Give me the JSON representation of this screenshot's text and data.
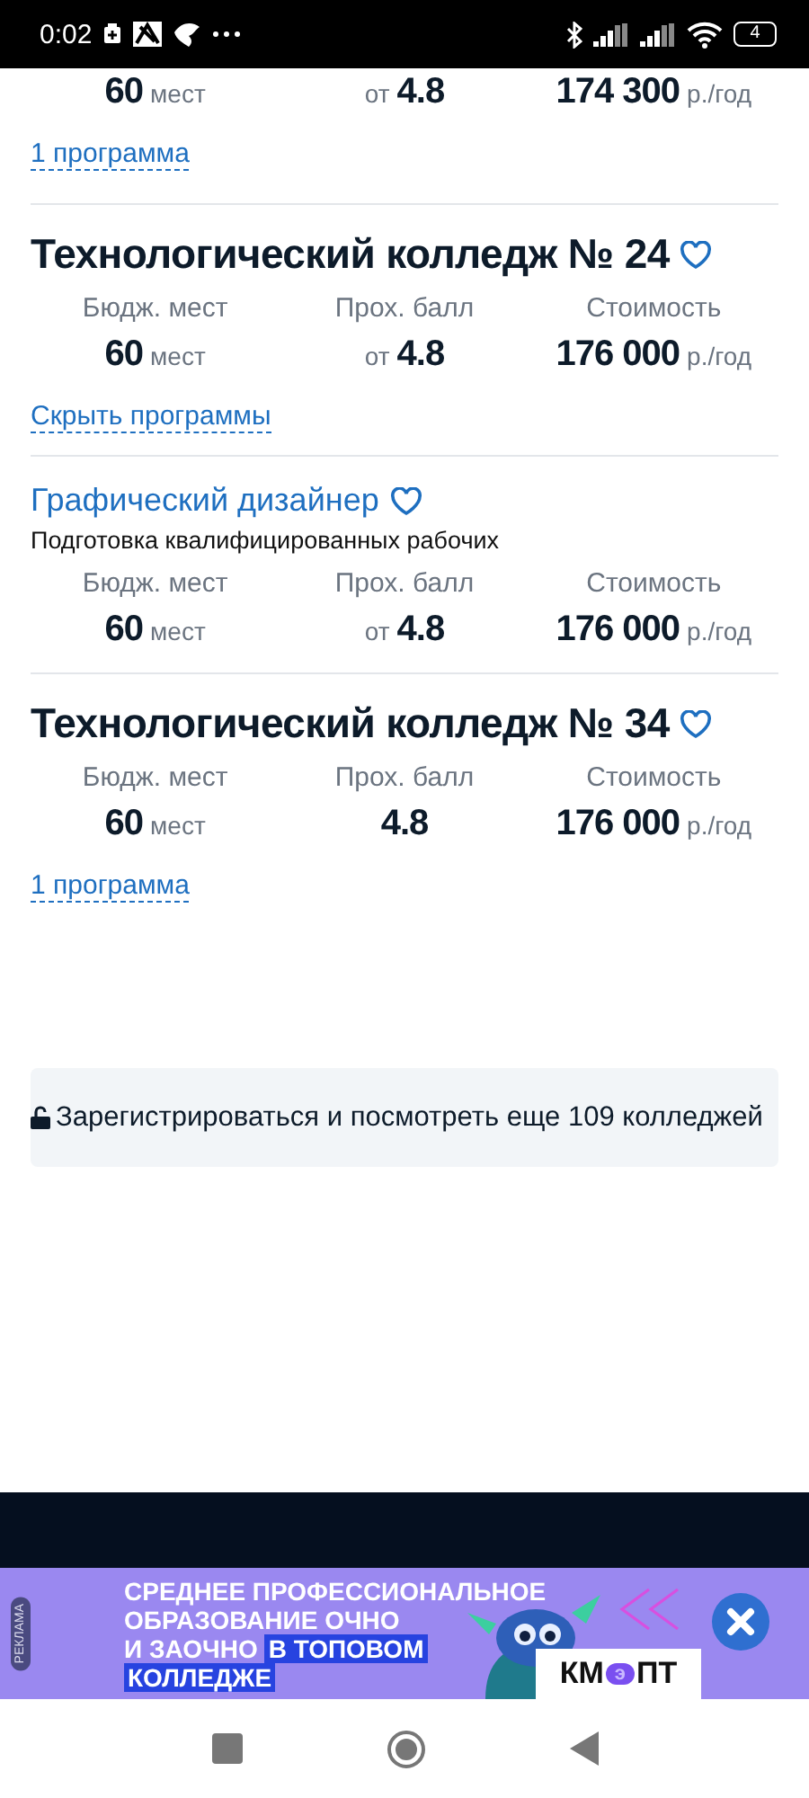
{
  "status_bar": {
    "time": "0:02",
    "battery": "4"
  },
  "top_stats": [
    {
      "value": "60",
      "unit": "мест"
    },
    {
      "prefix": "от",
      "value": "4.8"
    },
    {
      "value": "174 300",
      "unit": "р./год"
    }
  ],
  "top_link": "1 программа",
  "entries": [
    {
      "kind": "college",
      "title": "Технологический колледж № 24",
      "favorite": false,
      "stats": [
        {
          "label": "Бюдж. мест",
          "value": "60",
          "unit": "мест"
        },
        {
          "label": "Прох. балл",
          "prefix": "от",
          "value": "4.8"
        },
        {
          "label": "Стоимость",
          "value": "176 000",
          "unit": "р./год"
        }
      ],
      "link": "Скрыть программы"
    },
    {
      "kind": "program",
      "title": "Графический дизайнер",
      "favorite": false,
      "subtitle": "Подготовка квалифицированных рабочих",
      "stats": [
        {
          "label": "Бюдж. мест",
          "value": "60",
          "unit": "мест"
        },
        {
          "label": "Прох. балл",
          "prefix": "от",
          "value": "4.8"
        },
        {
          "label": "Стоимость",
          "value": "176 000",
          "unit": "р./год"
        }
      ]
    },
    {
      "kind": "college",
      "title": "Технологический колледж № 34",
      "favorite": false,
      "stats": [
        {
          "label": "Бюдж. мест",
          "value": "60",
          "unit": "мест"
        },
        {
          "label": "Прох. балл",
          "value": "4.8"
        },
        {
          "label": "Стоимость",
          "value": "176 000",
          "unit": "р./год"
        }
      ],
      "link": "1 программа"
    }
  ],
  "register_button": "Зарегистрироваться и посмотреть еще 109 колледжей",
  "ad": {
    "label": "РЕКЛАМА",
    "headline": [
      [
        {
          "text": "СРЕДНЕЕ ПРОФЕССИОНАЛЬНОЕ",
          "highlight": false
        }
      ],
      [
        {
          "text": "ОБРАЗОВАНИЕ ОЧНО",
          "highlight": false
        }
      ],
      [
        {
          "text": "И ЗАОЧНО",
          "highlight": false
        },
        {
          "text": "В ТОПОВОМ",
          "highlight": true
        }
      ],
      [
        {
          "text": "КОЛЛЕДЖЕ",
          "highlight": true
        }
      ]
    ],
    "logo": {
      "left": "КМ",
      "middle": "э",
      "right": "ПТ"
    }
  }
}
